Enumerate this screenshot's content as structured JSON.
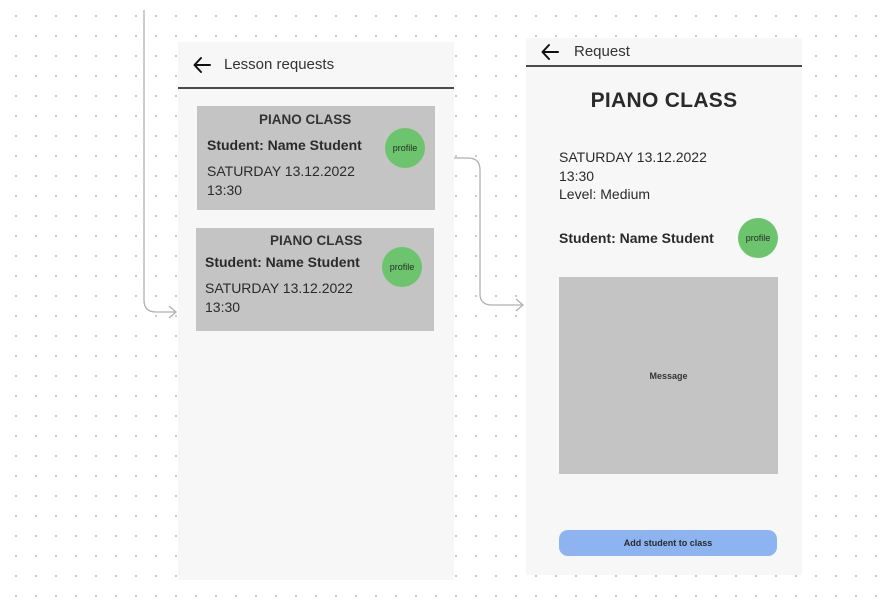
{
  "list_screen": {
    "title": "Lesson requests",
    "cards": [
      {
        "class_name": "PIANO CLASS",
        "student": "Student:  Name Student",
        "date": "SATURDAY 13.12.2022",
        "time": "13:30",
        "profile_label": "profile"
      },
      {
        "class_name": "PIANO CLASS",
        "student": "Student:  Name Student",
        "date": "SATURDAY 13.12.2022",
        "time": "13:30",
        "profile_label": "profile"
      }
    ]
  },
  "detail_screen": {
    "title": "Request",
    "class_name": "PIANO CLASS",
    "date": "SATURDAY 13.12.2022",
    "time": "13:30",
    "level": "Level: Medium",
    "student": "Student:  Name Student",
    "profile_label": "profile",
    "message_label": "Message",
    "add_button_label": "Add student to class"
  },
  "colors": {
    "screen_bg": "#f7f7f7",
    "card_bg": "#c4c4c4",
    "profile_green": "#6cc56c",
    "button_blue": "#8db4f0",
    "connector": "#b0b0b0"
  },
  "icons": {
    "back": "arrow-left-icon"
  }
}
